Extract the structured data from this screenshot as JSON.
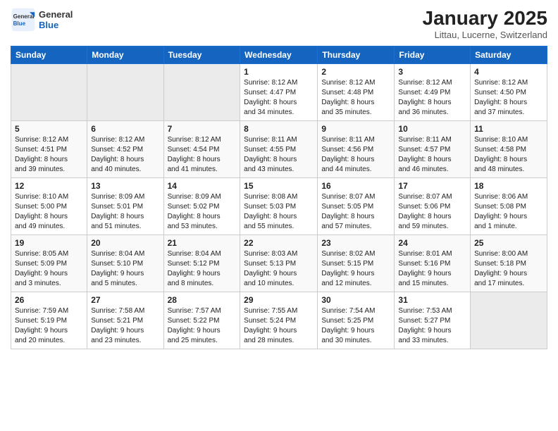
{
  "header": {
    "logo_general": "General",
    "logo_blue": "Blue",
    "month_year": "January 2025",
    "location": "Littau, Lucerne, Switzerland"
  },
  "days_of_week": [
    "Sunday",
    "Monday",
    "Tuesday",
    "Wednesday",
    "Thursday",
    "Friday",
    "Saturday"
  ],
  "weeks": [
    [
      {
        "num": "",
        "info": ""
      },
      {
        "num": "",
        "info": ""
      },
      {
        "num": "",
        "info": ""
      },
      {
        "num": "1",
        "info": "Sunrise: 8:12 AM\nSunset: 4:47 PM\nDaylight: 8 hours\nand 34 minutes."
      },
      {
        "num": "2",
        "info": "Sunrise: 8:12 AM\nSunset: 4:48 PM\nDaylight: 8 hours\nand 35 minutes."
      },
      {
        "num": "3",
        "info": "Sunrise: 8:12 AM\nSunset: 4:49 PM\nDaylight: 8 hours\nand 36 minutes."
      },
      {
        "num": "4",
        "info": "Sunrise: 8:12 AM\nSunset: 4:50 PM\nDaylight: 8 hours\nand 37 minutes."
      }
    ],
    [
      {
        "num": "5",
        "info": "Sunrise: 8:12 AM\nSunset: 4:51 PM\nDaylight: 8 hours\nand 39 minutes."
      },
      {
        "num": "6",
        "info": "Sunrise: 8:12 AM\nSunset: 4:52 PM\nDaylight: 8 hours\nand 40 minutes."
      },
      {
        "num": "7",
        "info": "Sunrise: 8:12 AM\nSunset: 4:54 PM\nDaylight: 8 hours\nand 41 minutes."
      },
      {
        "num": "8",
        "info": "Sunrise: 8:11 AM\nSunset: 4:55 PM\nDaylight: 8 hours\nand 43 minutes."
      },
      {
        "num": "9",
        "info": "Sunrise: 8:11 AM\nSunset: 4:56 PM\nDaylight: 8 hours\nand 44 minutes."
      },
      {
        "num": "10",
        "info": "Sunrise: 8:11 AM\nSunset: 4:57 PM\nDaylight: 8 hours\nand 46 minutes."
      },
      {
        "num": "11",
        "info": "Sunrise: 8:10 AM\nSunset: 4:58 PM\nDaylight: 8 hours\nand 48 minutes."
      }
    ],
    [
      {
        "num": "12",
        "info": "Sunrise: 8:10 AM\nSunset: 5:00 PM\nDaylight: 8 hours\nand 49 minutes."
      },
      {
        "num": "13",
        "info": "Sunrise: 8:09 AM\nSunset: 5:01 PM\nDaylight: 8 hours\nand 51 minutes."
      },
      {
        "num": "14",
        "info": "Sunrise: 8:09 AM\nSunset: 5:02 PM\nDaylight: 8 hours\nand 53 minutes."
      },
      {
        "num": "15",
        "info": "Sunrise: 8:08 AM\nSunset: 5:03 PM\nDaylight: 8 hours\nand 55 minutes."
      },
      {
        "num": "16",
        "info": "Sunrise: 8:07 AM\nSunset: 5:05 PM\nDaylight: 8 hours\nand 57 minutes."
      },
      {
        "num": "17",
        "info": "Sunrise: 8:07 AM\nSunset: 5:06 PM\nDaylight: 8 hours\nand 59 minutes."
      },
      {
        "num": "18",
        "info": "Sunrise: 8:06 AM\nSunset: 5:08 PM\nDaylight: 9 hours\nand 1 minute."
      }
    ],
    [
      {
        "num": "19",
        "info": "Sunrise: 8:05 AM\nSunset: 5:09 PM\nDaylight: 9 hours\nand 3 minutes."
      },
      {
        "num": "20",
        "info": "Sunrise: 8:04 AM\nSunset: 5:10 PM\nDaylight: 9 hours\nand 5 minutes."
      },
      {
        "num": "21",
        "info": "Sunrise: 8:04 AM\nSunset: 5:12 PM\nDaylight: 9 hours\nand 8 minutes."
      },
      {
        "num": "22",
        "info": "Sunrise: 8:03 AM\nSunset: 5:13 PM\nDaylight: 9 hours\nand 10 minutes."
      },
      {
        "num": "23",
        "info": "Sunrise: 8:02 AM\nSunset: 5:15 PM\nDaylight: 9 hours\nand 12 minutes."
      },
      {
        "num": "24",
        "info": "Sunrise: 8:01 AM\nSunset: 5:16 PM\nDaylight: 9 hours\nand 15 minutes."
      },
      {
        "num": "25",
        "info": "Sunrise: 8:00 AM\nSunset: 5:18 PM\nDaylight: 9 hours\nand 17 minutes."
      }
    ],
    [
      {
        "num": "26",
        "info": "Sunrise: 7:59 AM\nSunset: 5:19 PM\nDaylight: 9 hours\nand 20 minutes."
      },
      {
        "num": "27",
        "info": "Sunrise: 7:58 AM\nSunset: 5:21 PM\nDaylight: 9 hours\nand 23 minutes."
      },
      {
        "num": "28",
        "info": "Sunrise: 7:57 AM\nSunset: 5:22 PM\nDaylight: 9 hours\nand 25 minutes."
      },
      {
        "num": "29",
        "info": "Sunrise: 7:55 AM\nSunset: 5:24 PM\nDaylight: 9 hours\nand 28 minutes."
      },
      {
        "num": "30",
        "info": "Sunrise: 7:54 AM\nSunset: 5:25 PM\nDaylight: 9 hours\nand 30 minutes."
      },
      {
        "num": "31",
        "info": "Sunrise: 7:53 AM\nSunset: 5:27 PM\nDaylight: 9 hours\nand 33 minutes."
      },
      {
        "num": "",
        "info": ""
      }
    ]
  ]
}
